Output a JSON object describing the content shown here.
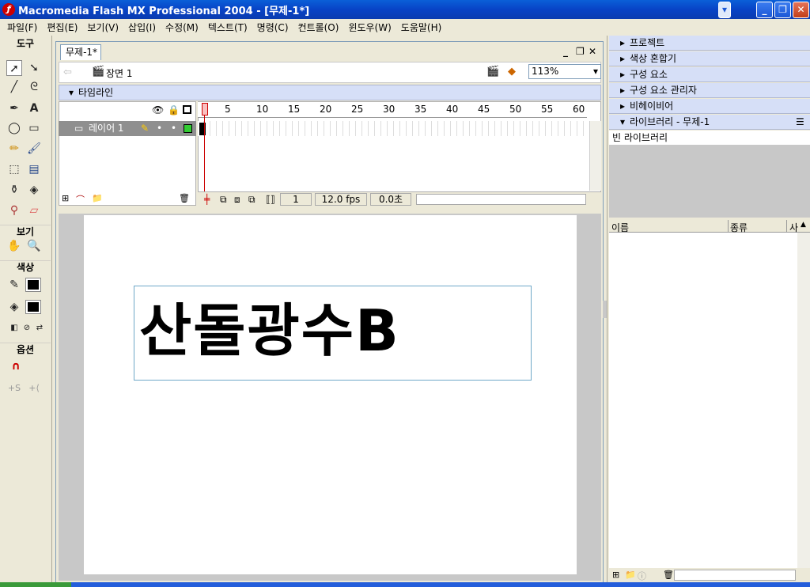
{
  "window": {
    "title": "Macromedia Flash MX Professional 2004 - [무제-1*]"
  },
  "menu": [
    "파일(F)",
    "편집(E)",
    "보기(V)",
    "삽입(I)",
    "수정(M)",
    "텍스트(T)",
    "명령(C)",
    "컨트롤(O)",
    "윈도우(W)",
    "도움말(H)"
  ],
  "tools": {
    "title": "도구",
    "view_label": "보기",
    "color_label": "색상",
    "options_label": "옵션"
  },
  "document": {
    "tab": "무제-1*",
    "scene": "장면 1",
    "zoom": "113%",
    "timeline_label": "타임라인",
    "layer_name": "레이어 1",
    "frame_ticks": [
      "1",
      "5",
      "10",
      "15",
      "20",
      "25",
      "30",
      "35",
      "40",
      "45",
      "50",
      "55",
      "60"
    ],
    "current_frame": "1",
    "fps": "12.0 fps",
    "elapsed": "0.0초",
    "stage_text": "산돌광수B"
  },
  "panels": {
    "project": "프로젝트",
    "color_mixer": "색상 혼합기",
    "components": "구성 요소",
    "component_inspector": "구성 요소 관리자",
    "behaviors": "비헤이비어",
    "library": "라이브러리 - 무제-1",
    "library_empty": "빈 라이브러리",
    "col_name": "이름",
    "col_kind": "종류",
    "col_use": "사"
  }
}
